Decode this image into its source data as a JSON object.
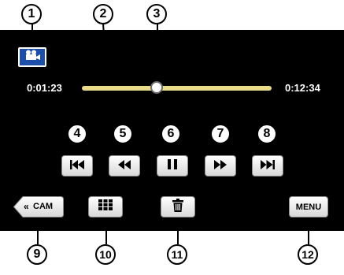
{
  "callouts": [
    "1",
    "2",
    "3",
    "4",
    "5",
    "6",
    "7",
    "8",
    "9",
    "10",
    "11",
    "12"
  ],
  "playback": {
    "elapsed_time": "0:01:23",
    "total_time": "0:12:34",
    "progress_fraction": 0.3
  },
  "buttons": {
    "video_mode_icon": "video-camera-icon",
    "skip_back_icon": "skip-previous-icon",
    "rewind_icon": "rewind-icon",
    "pause_icon": "pause-icon",
    "fast_forward_icon": "fast-forward-icon",
    "skip_forward_icon": "skip-next-icon",
    "cam_label": "CAM",
    "index_icon": "thumbnail-grid-icon",
    "delete_icon": "trash-icon",
    "menu_label": "MENU"
  },
  "colors": {
    "screen_bg": "#000000",
    "seek_bar": "#e8dc8a",
    "button_face": "#f2f2f2"
  }
}
